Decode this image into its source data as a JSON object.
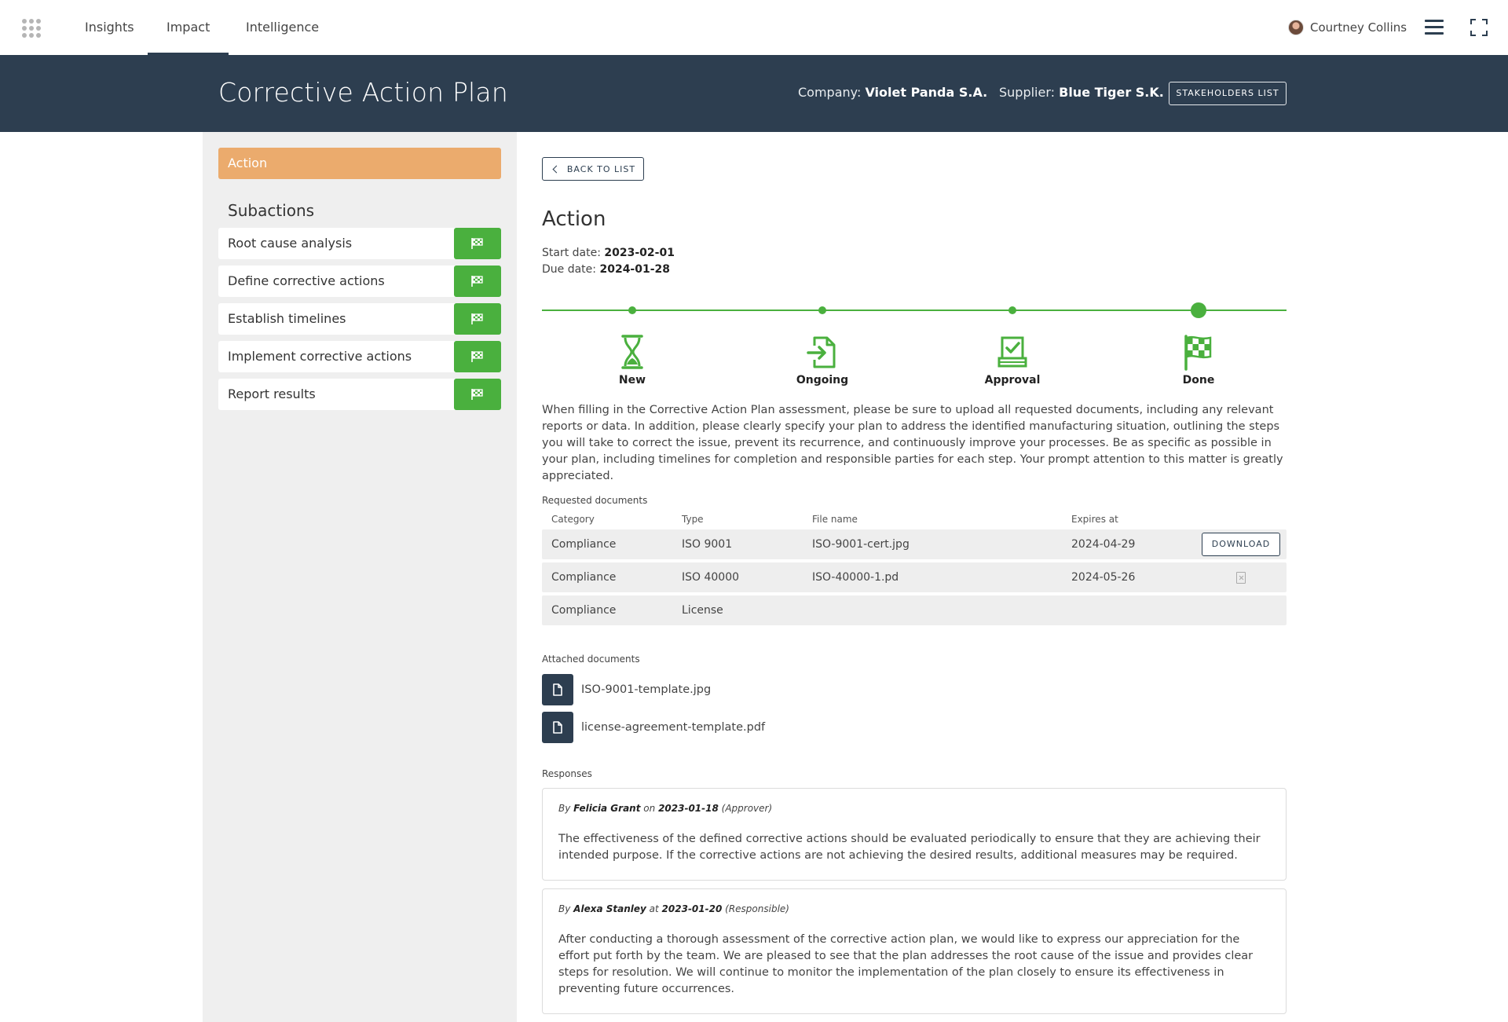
{
  "topnav": {
    "tabs": [
      {
        "label": "Insights",
        "active": false
      },
      {
        "label": "Impact",
        "active": true
      },
      {
        "label": "Intelligence",
        "active": false
      }
    ],
    "user_name": "Courtney Collins",
    "icons": [
      "apps-grid-icon",
      "avatar",
      "hamburger-menu-icon",
      "fullscreen-icon"
    ]
  },
  "header": {
    "title": "Corrective Action Plan",
    "company_label": "Company:",
    "company_value": "Violet Panda S.A.",
    "supplier_label": "Supplier:",
    "supplier_value": "Blue Tiger S.K.",
    "stakeholders_button": "STAKEHOLDERS LIST",
    "background_color": "#2d3e50"
  },
  "sidebar": {
    "action_label": "Action",
    "action_color": "#ebab6d",
    "subactions_title": "Subactions",
    "subactions": [
      {
        "label": "Root cause analysis",
        "icon": "flag-icon"
      },
      {
        "label": "Define corrective actions",
        "icon": "flag-icon"
      },
      {
        "label": "Establish timelines",
        "icon": "flag-icon"
      },
      {
        "label": "Implement corrective actions",
        "icon": "flag-icon"
      },
      {
        "label": "Report results",
        "icon": "flag-icon"
      }
    ],
    "flag_button_color": "#4ab03e"
  },
  "main": {
    "back_button": "BACK TO LIST",
    "title": "Action",
    "start_date_label": "Start date:",
    "start_date": "2023-02-01",
    "due_date_label": "Due date:",
    "due_date": "2024-01-28",
    "timeline": {
      "accent_color": "#4ab03e",
      "current_step": "Done",
      "steps": [
        {
          "label": "New",
          "icon": "hourglass-icon"
        },
        {
          "label": "Ongoing",
          "icon": "file-import-icon"
        },
        {
          "label": "Approval",
          "icon": "approval-check-icon"
        },
        {
          "label": "Done",
          "icon": "checkered-flag-icon"
        }
      ]
    },
    "description": "When filling in the Corrective Action Plan assessment, please be sure to upload all requested documents, including any relevant reports or data. In addition, please clearly specify your plan to address the identified manufacturing situation, outlining the steps you will take to correct the issue, prevent its recurrence, and continuously improve your processes. Be as specific as possible in your plan, including timelines for completion and responsible parties for each step. Your prompt attention to this matter is greatly appreciated.",
    "requested_documents": {
      "label": "Requested documents",
      "columns": [
        "Category",
        "Type",
        "File name",
        "Expires at"
      ],
      "rows": [
        {
          "category": "Compliance",
          "type": "ISO 9001",
          "file_name": "ISO-9001-cert.jpg",
          "expires_at": "2024-04-29",
          "action": "DOWNLOAD"
        },
        {
          "category": "Compliance",
          "type": "ISO 40000",
          "file_name": "ISO-40000-1.pd",
          "expires_at": "2024-05-26",
          "action": "file-missing-icon"
        },
        {
          "category": "Compliance",
          "type": "License",
          "file_name": "",
          "expires_at": "",
          "action": ""
        }
      ]
    },
    "attached_documents": {
      "label": "Attached documents",
      "files": [
        "ISO-9001-template.jpg",
        "license-agreement-template.pdf"
      ]
    },
    "responses": {
      "label": "Responses",
      "items": [
        {
          "by": "By",
          "author": "Felicia Grant",
          "connector": "on",
          "date": "2023-01-18",
          "role": "(Approver)",
          "text": "The effectiveness of the defined corrective actions should be evaluated periodically to ensure that they are achieving their intended purpose. If the corrective actions are not achieving the desired results, additional measures may be required."
        },
        {
          "by": "By",
          "author": "Alexa Stanley",
          "connector": "at",
          "date": "2023-01-20",
          "role": "(Responsible)",
          "text": "After conducting a thorough assessment of the corrective action plan, we would like to express our appreciation for the effort put forth by the team. We are pleased to see that the plan addresses the root cause of the issue and provides clear steps for resolution. We will continue to monitor the implementation of the plan closely to ensure its effectiveness in preventing future occurrences."
        }
      ]
    }
  }
}
